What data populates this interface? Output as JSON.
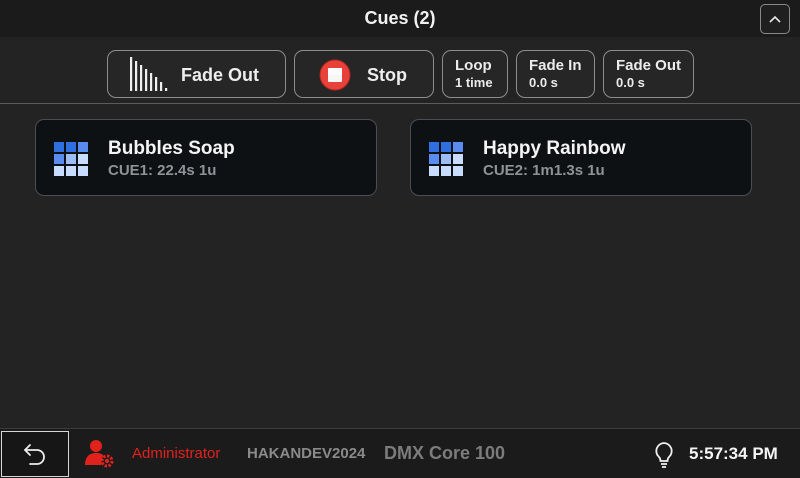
{
  "header": {
    "title": "Cues (2)",
    "collapse_icon": "chevron-up-icon"
  },
  "toolbar": {
    "fade_out_label": "Fade Out",
    "fade_out_icon": "fade-bars-icon",
    "stop_label": "Stop",
    "stop_icon": "stop-icon",
    "loop": {
      "label": "Loop",
      "value": "1 time"
    },
    "fade_in": {
      "label": "Fade In",
      "value": "0.0 s"
    },
    "fade_out_time": {
      "label": "Fade Out",
      "value": "0.0 s"
    }
  },
  "cues": [
    {
      "name": "Bubbles Soap",
      "info": "CUE1: 22.4s 1u",
      "icon": "grid-icon"
    },
    {
      "name": "Happy Rainbow",
      "info": "CUE2: 1m1.3s 1u",
      "icon": "grid-icon"
    }
  ],
  "footer": {
    "back_icon": "undo-arrow-icon",
    "user_icon": "user-gear-icon",
    "user_role": "Administrator",
    "device_id": "HAKANDEV2024",
    "device_model": "DMX Core 100",
    "bulb_icon": "lightbulb-icon",
    "time": "5:57:34 PM"
  },
  "colors": {
    "background": "#232323",
    "header_bg": "#1b1b1b",
    "card_bg": "#0e1114",
    "accent_red": "#e0221d",
    "grid_blue": "#2f6fe0",
    "grid_light": "#c7dcff"
  }
}
